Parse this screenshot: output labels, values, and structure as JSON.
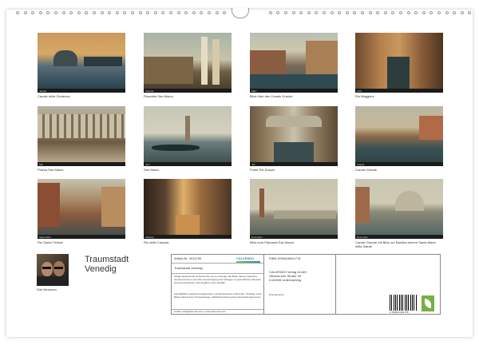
{
  "months": [
    {
      "month": "Januar",
      "caption": "Canale della Giudecca"
    },
    {
      "month": "Februar",
      "caption": "Piazzetta San Marco"
    },
    {
      "month": "März",
      "caption": "Blick über den Canale Grande"
    },
    {
      "month": "April",
      "caption": "Rio Maggiore"
    },
    {
      "month": "Mai",
      "caption": "Piazza San Marco"
    },
    {
      "month": "Juni",
      "caption": "San Marco"
    },
    {
      "month": "Juli",
      "caption": "Ponte Dei Sospiri"
    },
    {
      "month": "August",
      "caption": "Canale Grande"
    },
    {
      "month": "September",
      "caption": "Rio Santa Trinitas"
    },
    {
      "month": "Oktober",
      "caption": "Rio della Casuola"
    },
    {
      "month": "November",
      "caption": "Blick vom Piazzetta San Marco"
    },
    {
      "month": "Dezember",
      "caption": "Canale Grande mit Blick zur Basilica minore Santa Maria della Salute"
    }
  ],
  "title_line1": "Traumstadt",
  "title_line2": "Venedig",
  "author": "Dirk Meutzner",
  "article": "Artikel-Nr. 2014790",
  "calendar_name": "Traumstadt Venedig",
  "brand": "CALVENDO",
  "isbn": "ISBN 9783616001778",
  "publisher": [
    "CALVENDO Verlag GmbH",
    "Ottobrunner Straße 39",
    "D-82008 Unterhaching"
  ],
  "author_small": "Dirk Meutzner",
  "legal_text": "Infolge bestehender Schutzrechte ist es untersagt, die Bilder dieses Kalenders herauszutrennen und ohne Genehmigung des Verlages zu gewerblichen Zwecken weiterzuverarbeiten. Alle Angaben ohne Gewähr.",
  "produced_text": "CALVENDO produziert textgebunden und klimaneutral in DE & EU. Produkte CO2-Bilanz dank kurzer Transportwege. Abfall-Reduzierung beim Entwicklungsprozess.",
  "contact": "E-Mail: info@calvendo.com • www.calvendo.com",
  "barcode_number": "9 783616 001778",
  "colors": {
    "page": "#ffffff",
    "brand_blue": "#2a8bbf",
    "brand_green": "#78b043"
  }
}
